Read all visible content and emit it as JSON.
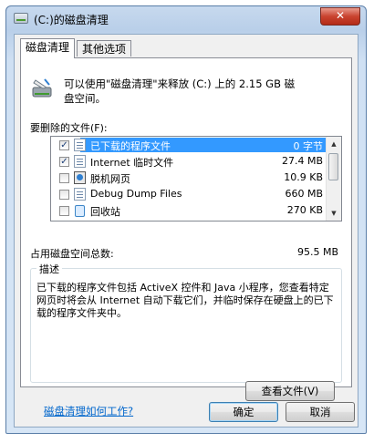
{
  "window": {
    "title": "(C:)的磁盘清理",
    "close_label": "✕"
  },
  "tabs": [
    {
      "label": "磁盘清理",
      "active": true
    },
    {
      "label": "其他选项",
      "active": false
    }
  ],
  "intro": {
    "line1": "可以使用\"磁盘清理\"来释放  (C:) 上的 2.15 GB 磁",
    "line2": "盘空间。"
  },
  "files_label": "要删除的文件(F):",
  "files": [
    {
      "name": "已下载的程序文件",
      "size": "0 字节",
      "checked": true,
      "selected": true,
      "icon": "folder-doc-icon"
    },
    {
      "name": "Internet 临时文件",
      "size": "27.4 MB",
      "checked": true,
      "selected": false,
      "icon": "doc-icon"
    },
    {
      "name": "脱机网页",
      "size": "10.9 KB",
      "checked": false,
      "selected": false,
      "icon": "network-page-icon"
    },
    {
      "name": "Debug Dump Files",
      "size": "660 MB",
      "checked": false,
      "selected": false,
      "icon": "blank-icon"
    },
    {
      "name": "回收站",
      "size": "270 KB",
      "checked": false,
      "selected": false,
      "icon": "recycle-bin-icon"
    }
  ],
  "total": {
    "label": "占用磁盘空间总数:",
    "value": "95.5 MB"
  },
  "description": {
    "legend": "描述",
    "text": "已下载的程序文件包括 ActiveX 控件和 Java 小程序，您查看特定网页时将会从 Internet 自动下载它们，并临时保存在硬盘上的已下载的程序文件夹中。"
  },
  "view_files_button": "查看文件(V)",
  "help_link": "磁盘清理如何工作?",
  "ok_button": "确定",
  "cancel_button": "取消",
  "colors": {
    "selection": "#3399ff",
    "link": "#0066cc",
    "close": "#c9432f"
  }
}
